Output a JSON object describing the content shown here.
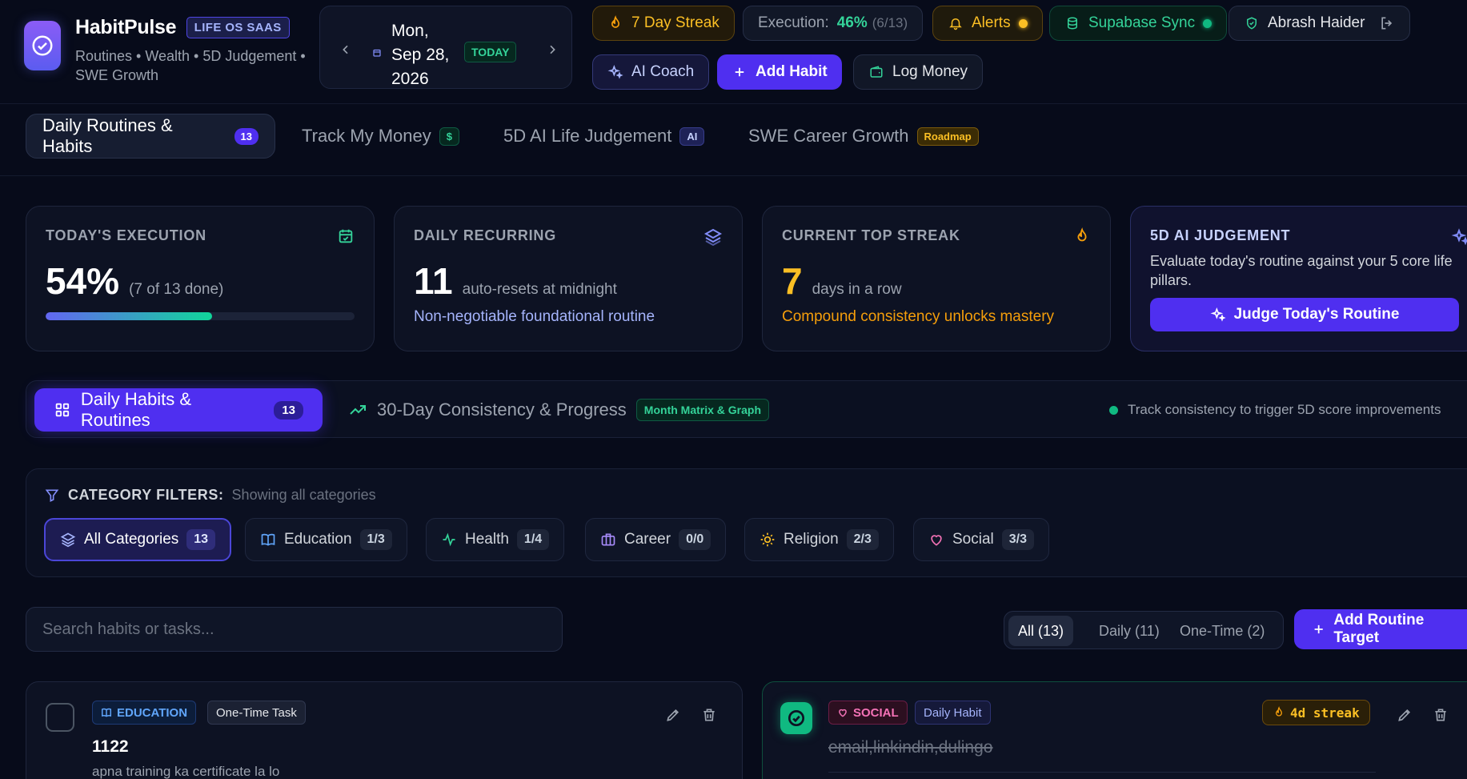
{
  "brand": {
    "name": "HabitPulse",
    "tag": "LIFE OS SAAS",
    "subtitle": "Routines • Wealth • 5D Judgement • SWE Growth"
  },
  "date": {
    "line1": "Mon,",
    "line2": "Sep 28,",
    "line3": "2026",
    "today_label": "TODAY"
  },
  "header": {
    "streak_label": "7 Day Streak",
    "execution_label": "Execution:",
    "execution_value": "46%",
    "execution_count": "(6/13)",
    "alerts_label": "Alerts",
    "sync_label": "Supabase Sync",
    "user_name": "Abrash Haider",
    "ai_coach_label": "AI Coach",
    "add_habit_label": "Add Habit",
    "log_money_label": "Log Money"
  },
  "nav": {
    "tabs": [
      {
        "label": "Daily Routines & Habits",
        "badge": "13"
      },
      {
        "label": "Track My Money",
        "badge": "$"
      },
      {
        "label": "5D AI Life Judgement",
        "badge": "AI"
      },
      {
        "label": "SWE Career Growth",
        "badge": "Roadmap"
      }
    ]
  },
  "stats": {
    "execution": {
      "title": "TODAY'S EXECUTION",
      "value": "54%",
      "detail": "(7 of 13 done)",
      "progress_percent": 54
    },
    "recurring": {
      "title": "DAILY RECURRING",
      "value": "11",
      "detail": "auto-resets at midnight",
      "footer": "Non-negotiable foundational routine"
    },
    "streak": {
      "title": "CURRENT TOP STREAK",
      "value": "7",
      "detail": "days in a row",
      "footer": "Compound consistency unlocks mastery"
    },
    "judgement": {
      "title": "5D AI JUDGEMENT",
      "desc": "Evaluate today's routine against your 5 core life pillars.",
      "button": "Judge Today's Routine"
    }
  },
  "subtabs": {
    "active_label": "Daily Habits & Routines",
    "active_count": "13",
    "second_label": "30-Day Consistency & Progress",
    "second_badge": "Month Matrix & Graph",
    "hint": "Track consistency to trigger 5D score improvements"
  },
  "filters": {
    "title": "CATEGORY FILTERS:",
    "subtitle": "Showing all categories",
    "items": [
      {
        "label": "All Categories",
        "count": "13"
      },
      {
        "label": "Education",
        "count": "1/3"
      },
      {
        "label": "Health",
        "count": "1/4"
      },
      {
        "label": "Career",
        "count": "0/0"
      },
      {
        "label": "Religion",
        "count": "2/3"
      },
      {
        "label": "Social",
        "count": "3/3"
      }
    ]
  },
  "search": {
    "placeholder": "Search habits or tasks..."
  },
  "view": {
    "all": "All (13)",
    "daily": "Daily (11)",
    "onetime": "One-Time (2)",
    "add_label": "Add Routine Target"
  },
  "habits": [
    {
      "category": "EDUCATION",
      "type": "One-Time Task",
      "title": "1122",
      "desc": "apna training ka certificate la lo"
    },
    {
      "category": "SOCIAL",
      "type": "Daily Habit",
      "title": "email,linkindin,dulingo",
      "streak": "4d streak"
    }
  ]
}
